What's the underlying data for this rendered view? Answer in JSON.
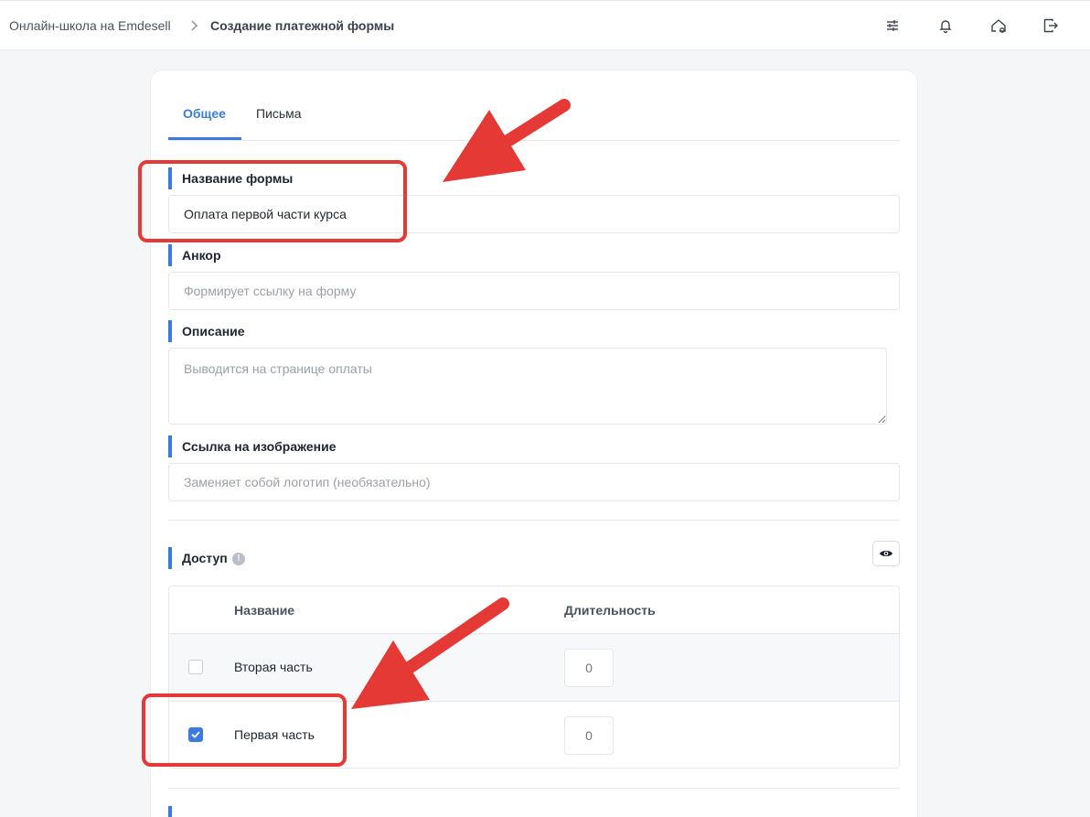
{
  "breadcrumb": {
    "root": "Онлайн-школа на Emdesell",
    "current": "Создание платежной формы"
  },
  "header_icons": [
    "sliders-icon",
    "bell-icon",
    "home-settings-icon",
    "logout-icon"
  ],
  "tabs": [
    {
      "label": "Общее",
      "active": true
    },
    {
      "label": "Письма",
      "active": false
    }
  ],
  "form": {
    "name": {
      "label": "Название формы",
      "value": "Оплата первой части курса"
    },
    "anchor": {
      "label": "Анкор",
      "placeholder": "Формирует ссылку на форму"
    },
    "description": {
      "label": "Описание",
      "placeholder": "Выводится на странице оплаты"
    },
    "image_link": {
      "label": "Ссылка на изображение",
      "placeholder": "Заменяет собой логотип (необязательно)"
    }
  },
  "access": {
    "label": "Доступ",
    "columns": [
      "Название",
      "Длительность"
    ],
    "rows": [
      {
        "name": "Вторая часть",
        "checked": false,
        "duration": "0"
      },
      {
        "name": "Первая часть",
        "checked": true,
        "duration": "0"
      }
    ]
  },
  "colors": {
    "accent": "#3b7ae0",
    "annotation": "#e53935"
  }
}
